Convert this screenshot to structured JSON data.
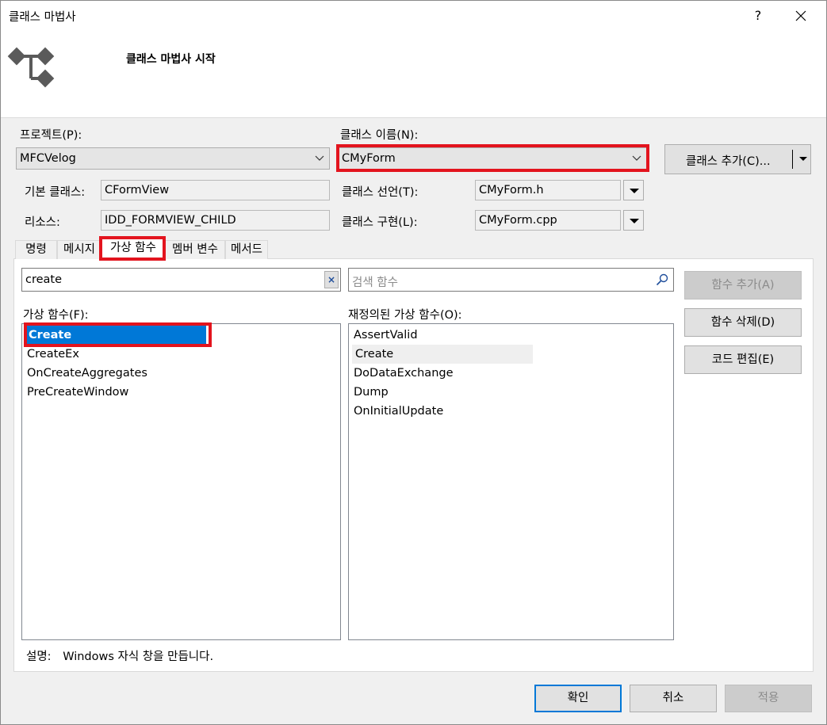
{
  "window": {
    "title": "클래스 마법사",
    "help_label": "?",
    "header_title": "클래스 마법사 시작"
  },
  "project": {
    "label": "프로젝트(P):",
    "value": "MFCVelog"
  },
  "class_name": {
    "label": "클래스 이름(N):",
    "value": "CMyForm"
  },
  "add_class_button": {
    "label": "클래스 추가(C)..."
  },
  "base_class": {
    "label": "기본 클래스:",
    "value": "CFormView"
  },
  "resource": {
    "label": "리소스:",
    "value": "IDD_FORMVIEW_CHILD"
  },
  "class_declaration": {
    "label": "클래스 선언(T):",
    "value": "CMyForm.h"
  },
  "class_implementation": {
    "label": "클래스 구현(L):",
    "value": "CMyForm.cpp"
  },
  "tabs": [
    {
      "label": "명령",
      "active": false
    },
    {
      "label": "메시지",
      "active": false
    },
    {
      "label": "가상 함수",
      "active": true
    },
    {
      "label": "멤버 변수",
      "active": false
    },
    {
      "label": "메서드",
      "active": false
    }
  ],
  "filter": {
    "value": "create",
    "clear_label": "×"
  },
  "search": {
    "placeholder": "검색 함수"
  },
  "virtual_functions": {
    "label": "가상 함수(F):",
    "items": [
      "Create",
      "CreateEx",
      "OnCreateAggregates",
      "PreCreateWindow"
    ],
    "selected": "Create"
  },
  "overridden_functions": {
    "label": "재정의된 가상 함수(O):",
    "items": [
      "AssertValid",
      "Create",
      "DoDataExchange",
      "Dump",
      "OnInitialUpdate"
    ],
    "highlighted": "Create"
  },
  "side_buttons": {
    "add": "함수 추가(A)",
    "delete": "함수 삭제(D)",
    "edit": "코드 편집(E)"
  },
  "description": {
    "label": "설명:",
    "text": "Windows 자식 창을 만듭니다."
  },
  "footer": {
    "ok": "확인",
    "cancel": "취소",
    "apply": "적용"
  },
  "colors": {
    "selection": "#0078d7",
    "highlight_box": "#e3141e"
  }
}
